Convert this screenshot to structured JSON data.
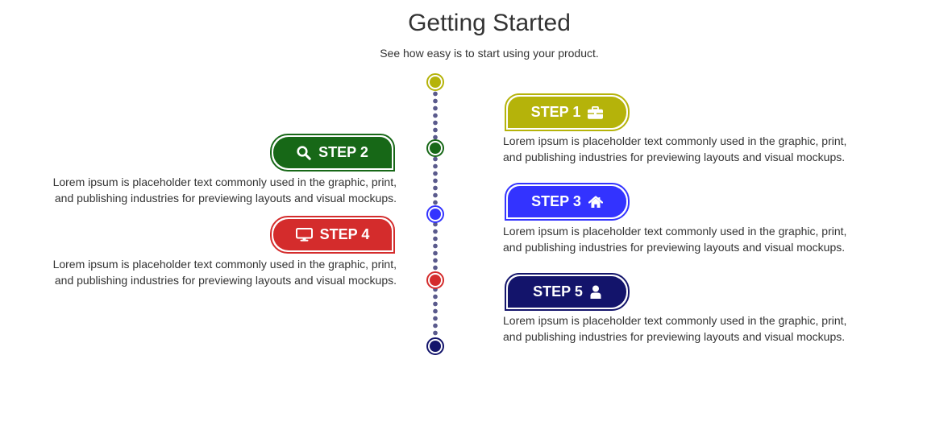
{
  "header": {
    "title": "Getting Started",
    "subtitle": "See how easy is to start using your product."
  },
  "steps": [
    {
      "label": "STEP 1",
      "icon": "briefcase-icon",
      "color": "#b5b30a",
      "side": "right",
      "description": "Lorem ipsum is placeholder text commonly used in the graphic, print, and publishing industries for previewing layouts and visual mockups."
    },
    {
      "label": "STEP 2",
      "icon": "search-icon",
      "color": "#176817",
      "side": "left",
      "description": "Lorem ipsum is placeholder text commonly used in the graphic, print, and publishing industries for previewing layouts and visual mockups."
    },
    {
      "label": "STEP 3",
      "icon": "home-icon",
      "color": "#3333ff",
      "side": "right",
      "description": "Lorem ipsum is placeholder text commonly used in the graphic, print, and publishing industries for previewing layouts and visual mockups."
    },
    {
      "label": "STEP 4",
      "icon": "monitor-icon",
      "color": "#d42c2c",
      "side": "left",
      "description": "Lorem ipsum is placeholder text commonly used in the graphic, print, and publishing industries for previewing layouts and visual mockups."
    },
    {
      "label": "STEP 5",
      "icon": "user-icon",
      "color": "#13146b",
      "side": "right",
      "description": "Lorem ipsum is placeholder text commonly used in the graphic, print, and publishing industries for previewing layouts and visual mockups."
    }
  ]
}
